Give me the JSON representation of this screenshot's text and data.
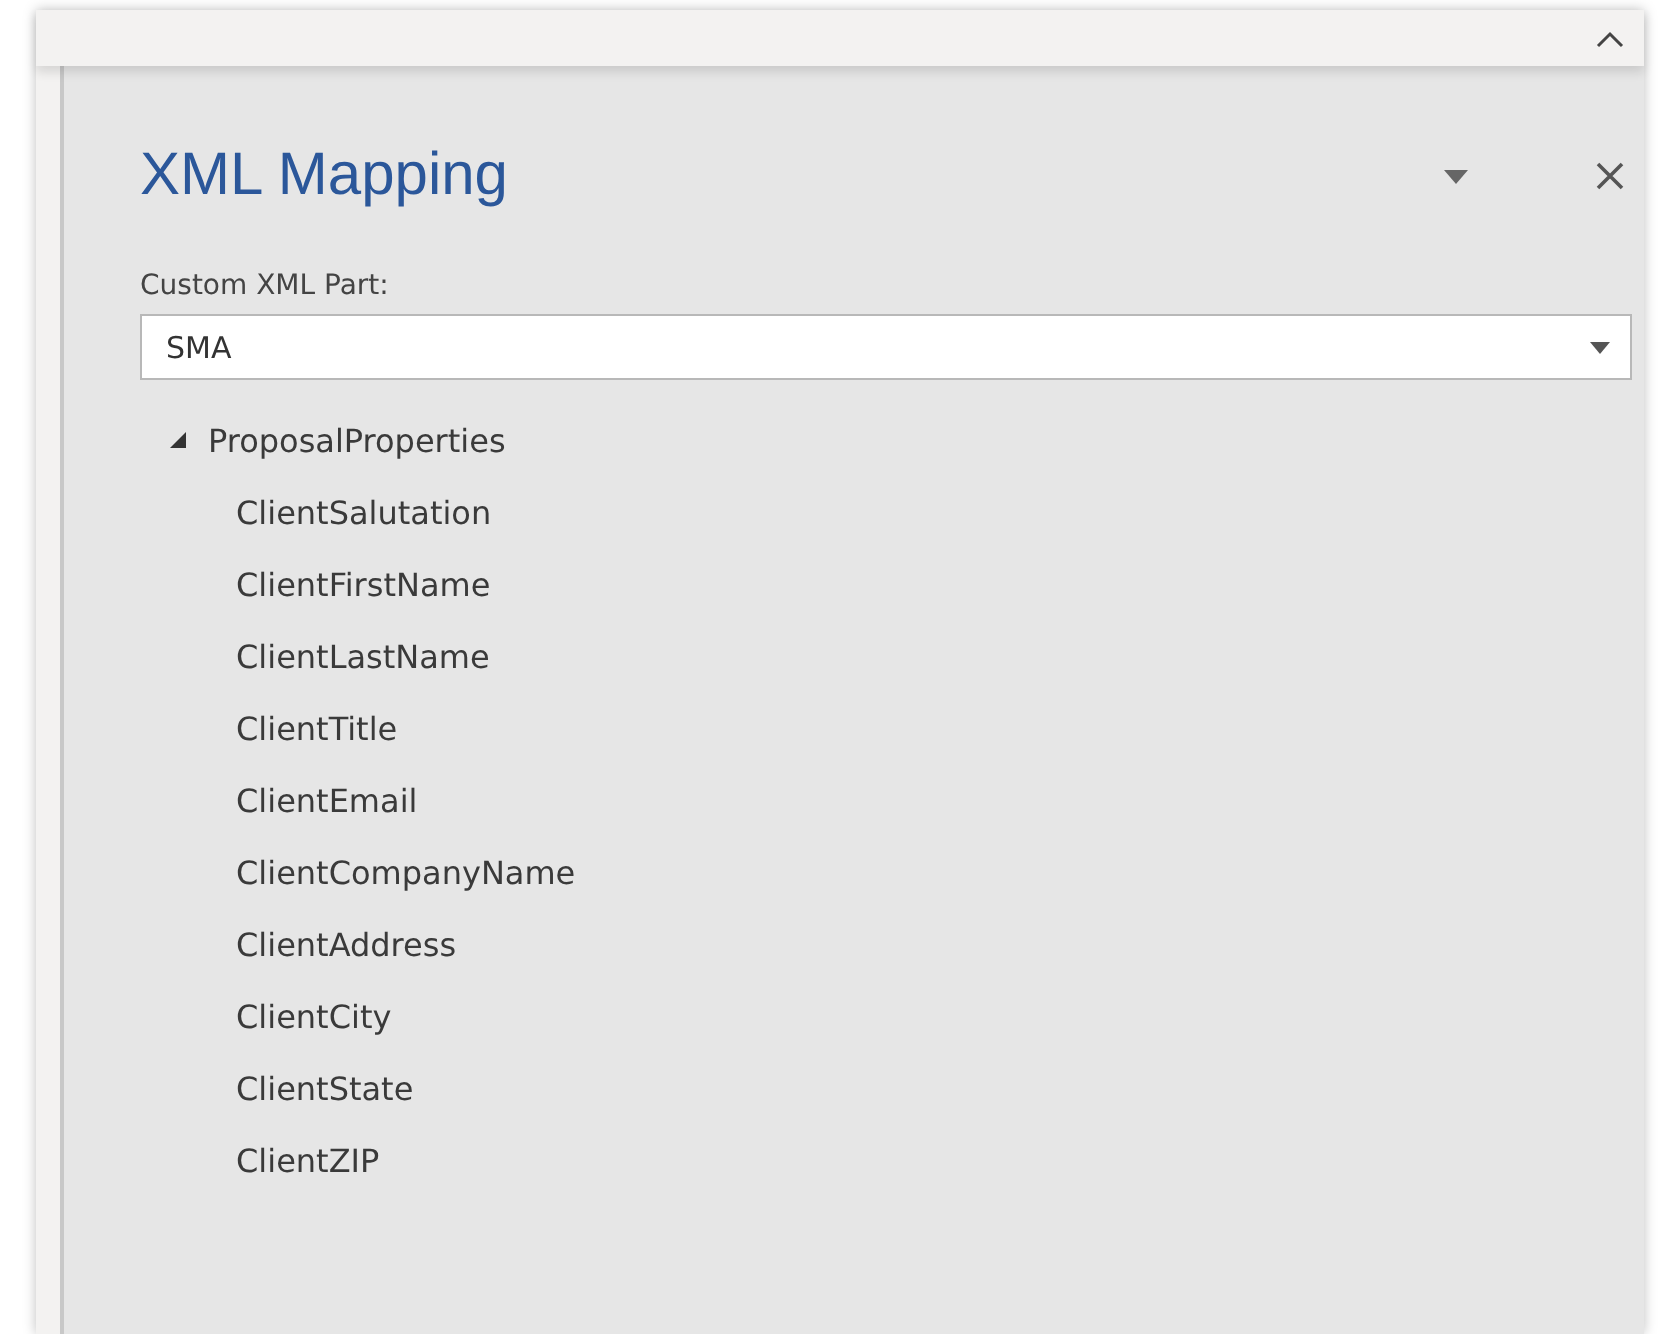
{
  "pane": {
    "title": "XML Mapping"
  },
  "custom_xml_part": {
    "label": "Custom XML Part:",
    "value": "SMA"
  },
  "tree": [
    {
      "label": "ProposalProperties",
      "expanded": true,
      "children": [
        {
          "label": "ClientSalutation"
        },
        {
          "label": "ClientFirstName"
        },
        {
          "label": "ClientLastName"
        },
        {
          "label": "ClientTitle"
        },
        {
          "label": "ClientEmail"
        },
        {
          "label": "ClientCompanyName"
        },
        {
          "label": "ClientAddress"
        },
        {
          "label": "ClientCity"
        },
        {
          "label": "ClientState"
        },
        {
          "label": "ClientZIP"
        }
      ]
    }
  ]
}
